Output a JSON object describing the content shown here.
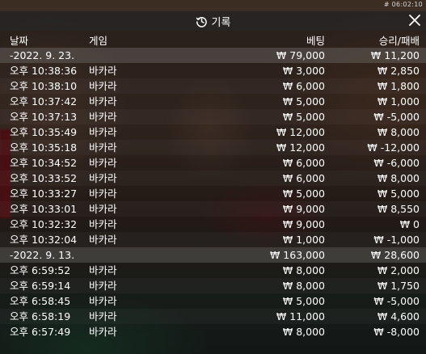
{
  "clock": "# 06:02:10",
  "window": {
    "title": "기록"
  },
  "columns": [
    "날짜",
    "게임",
    "베팅",
    "승리/패배"
  ],
  "groups": [
    {
      "date": "-2022. 9. 23.",
      "total_bet": "₩ 79,000",
      "total_result": "₩ 11,200",
      "rows": [
        {
          "time": "오후 10:38:36",
          "game": "바카라",
          "bet": "₩ 3,000",
          "result": "₩ 2,850"
        },
        {
          "time": "오후 10:38:10",
          "game": "바카라",
          "bet": "₩ 6,000",
          "result": "₩ 1,800"
        },
        {
          "time": "오후 10:37:42",
          "game": "바카라",
          "bet": "₩ 5,000",
          "result": "₩ 1,000"
        },
        {
          "time": "오후 10:37:13",
          "game": "바카라",
          "bet": "₩ 5,000",
          "result": "₩ -5,000"
        },
        {
          "time": "오후 10:35:49",
          "game": "바카라",
          "bet": "₩ 12,000",
          "result": "₩ 8,000"
        },
        {
          "time": "오후 10:35:18",
          "game": "바카라",
          "bet": "₩ 12,000",
          "result": "₩ -12,000"
        },
        {
          "time": "오후 10:34:52",
          "game": "바카라",
          "bet": "₩ 6,000",
          "result": "₩ -6,000"
        },
        {
          "time": "오후 10:33:52",
          "game": "바카라",
          "bet": "₩ 6,000",
          "result": "₩ 8,000"
        },
        {
          "time": "오후 10:33:27",
          "game": "바카라",
          "bet": "₩ 5,000",
          "result": "₩ 5,000"
        },
        {
          "time": "오후 10:33:01",
          "game": "바카라",
          "bet": "₩ 9,000",
          "result": "₩ 8,550"
        },
        {
          "time": "오후 10:32:32",
          "game": "바카라",
          "bet": "₩ 9,000",
          "result": "₩ 0"
        },
        {
          "time": "오후 10:32:04",
          "game": "바카라",
          "bet": "₩ 1,000",
          "result": "₩ -1,000"
        }
      ]
    },
    {
      "date": "-2022. 9. 13.",
      "total_bet": "₩ 163,000",
      "total_result": "₩ 28,600",
      "rows": [
        {
          "time": "오후 6:59:52",
          "game": "바카라",
          "bet": "₩ 8,000",
          "result": "₩ 2,000"
        },
        {
          "time": "오후 6:59:14",
          "game": "바카라",
          "bet": "₩ 8,000",
          "result": "₩ 1,750"
        },
        {
          "time": "오후 6:58:45",
          "game": "바카라",
          "bet": "₩ 5,000",
          "result": "₩ -5,000"
        },
        {
          "time": "오후 6:58:19",
          "game": "바카라",
          "bet": "₩ 11,000",
          "result": "₩ 4,600"
        },
        {
          "time": "오후 6:57:49",
          "game": "바카라",
          "bet": "₩ 8,000",
          "result": "₩ -8,000"
        }
      ]
    }
  ]
}
